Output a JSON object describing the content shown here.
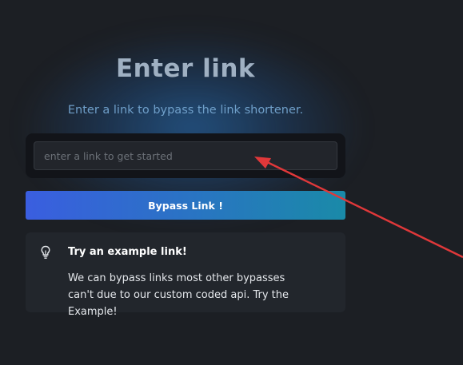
{
  "header": {
    "title": "Enter link",
    "subtitle": "Enter a link to bypass the link shortener."
  },
  "form": {
    "input_value": "",
    "input_placeholder": "enter a link to get started",
    "bypass_label": "Bypass Link !"
  },
  "example_card": {
    "icon": "lightbulb-icon",
    "title": "Try an example link!",
    "text": "We can bypass links most other bypasses can't due to our custom coded api. Try the Example!"
  },
  "colors": {
    "background": "#1c1f24",
    "accent_start": "#3a5ee0",
    "accent_end": "#1a8aa8",
    "annotation_arrow": "#e0383a"
  }
}
